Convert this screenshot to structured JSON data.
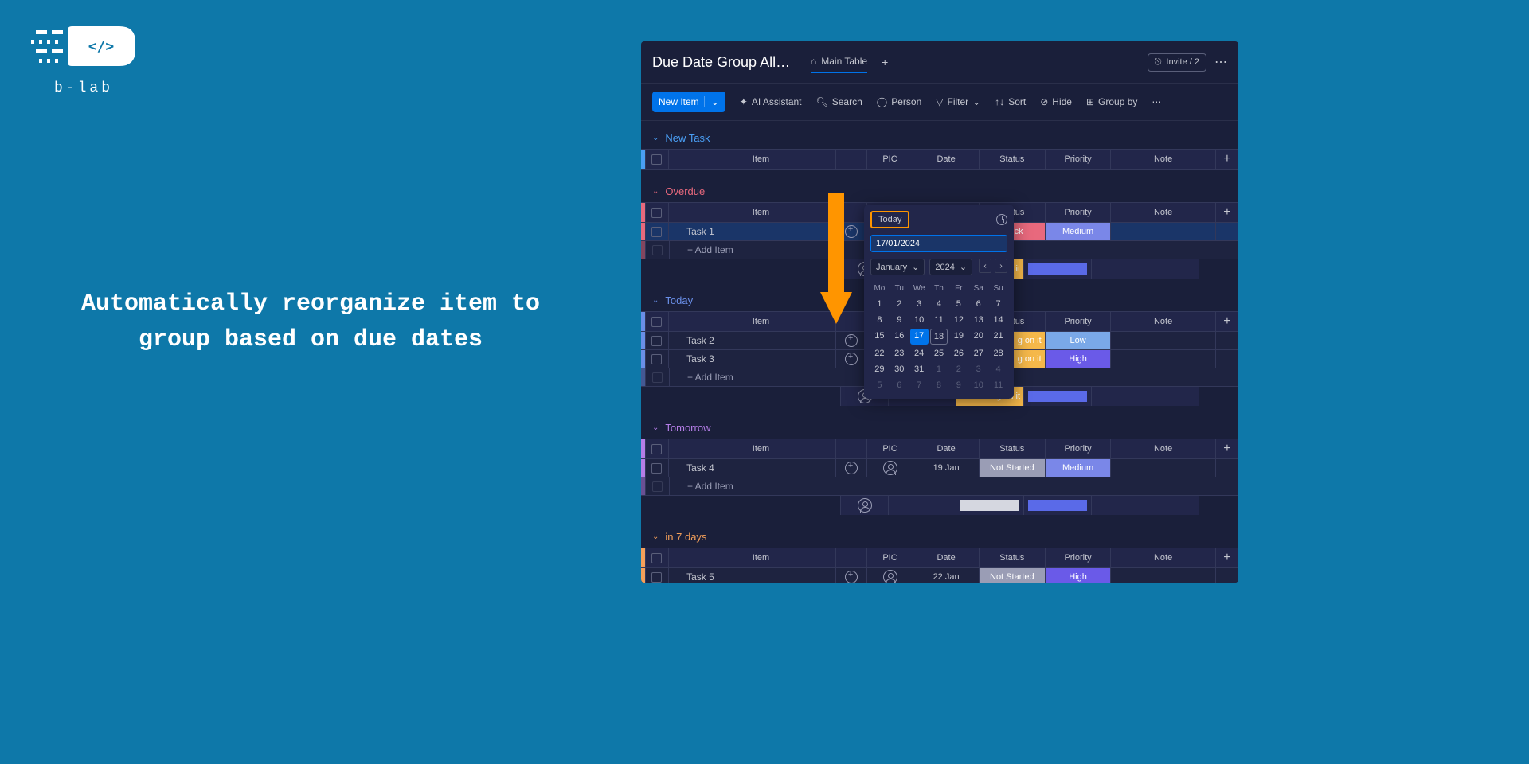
{
  "brand": {
    "name": "b-lab"
  },
  "tagline": "Automatically reorganize item to group based on due dates",
  "app": {
    "board_title": "Due Date Group Allocat",
    "main_tab": "Main Table",
    "invite_label": "Invite / 2",
    "toolbar": {
      "new_item": "New Item",
      "ai": "AI Assistant",
      "search": "Search",
      "person": "Person",
      "filter": "Filter",
      "sort": "Sort",
      "hide": "Hide",
      "group_by": "Group by"
    },
    "columns": {
      "item": "Item",
      "pic": "PIC",
      "date": "Date",
      "status": "Status",
      "priority": "Priority",
      "note": "Note"
    },
    "add_item": "+ Add Item",
    "groups": [
      {
        "id": "newtask",
        "title": "New Task",
        "rows": []
      },
      {
        "id": "overdue",
        "title": "Overdue",
        "rows": [
          {
            "item": "Task 1",
            "date": "17 Jan",
            "status": {
              "label": "Stuck",
              "color": "#e8697d"
            },
            "priority": {
              "label": "Medium",
              "color": "#7a87e8"
            },
            "selected": true
          }
        ],
        "sum_status_partial": [
          {
            "color": "#f5b84a",
            "label": "g on it"
          }
        ],
        "sum_priority_color": "#5a6ae8"
      },
      {
        "id": "today",
        "title": "Today",
        "rows": [
          {
            "item": "Task 2"
          },
          {
            "item": "Task 3"
          }
        ],
        "sum_status_partial": [
          {
            "color": "#f5b84a",
            "label": "g on it"
          },
          {
            "color": "#f5b84a",
            "label": "g on it"
          }
        ],
        "priority_partial": [
          {
            "label": "Low",
            "color": "#7aa8e8"
          },
          {
            "label": "High",
            "color": "#6a5ae8"
          }
        ],
        "sum_status_color": "#f5b84a",
        "sum_priority_color": "#5a6ae8"
      },
      {
        "id": "tomorrow",
        "title": "Tomorrow",
        "rows": [
          {
            "item": "Task 4",
            "date": "19 Jan",
            "status": {
              "label": "Not Started",
              "color": "#9a9db5"
            },
            "priority": {
              "label": "Medium",
              "color": "#7a87e8"
            }
          }
        ],
        "sum_status_color": "#d5d7e0",
        "sum_priority_color": "#5a6ae8"
      },
      {
        "id": "7days",
        "title": "in 7 days",
        "rows": [
          {
            "item": "Task 5",
            "date": "22 Jan",
            "status": {
              "label": "Not Started",
              "color": "#9a9db5"
            },
            "priority": {
              "label": "High",
              "color": "#6a5ae8"
            }
          }
        ],
        "sum_status_color": "#d5d7e0",
        "sum_priority_color": "#5a6ae8"
      }
    ],
    "datepicker": {
      "today_label": "Today",
      "input_value": "17/01/2024",
      "month": "January",
      "year": "2024",
      "dow": [
        "Mo",
        "Tu",
        "We",
        "Th",
        "Fr",
        "Sa",
        "Su"
      ],
      "weeks": [
        [
          1,
          2,
          3,
          4,
          5,
          6,
          7
        ],
        [
          8,
          9,
          10,
          11,
          12,
          13,
          14
        ],
        [
          15,
          16,
          17,
          18,
          19,
          20,
          21
        ],
        [
          22,
          23,
          24,
          25,
          26,
          27,
          28
        ],
        [
          29,
          30,
          31,
          1,
          2,
          3,
          4
        ],
        [
          5,
          6,
          7,
          8,
          9,
          10,
          11
        ]
      ],
      "selected_day": 17,
      "hover_day": 18,
      "muted_from_row": 4,
      "muted_from_col_in_row4": 3
    }
  }
}
